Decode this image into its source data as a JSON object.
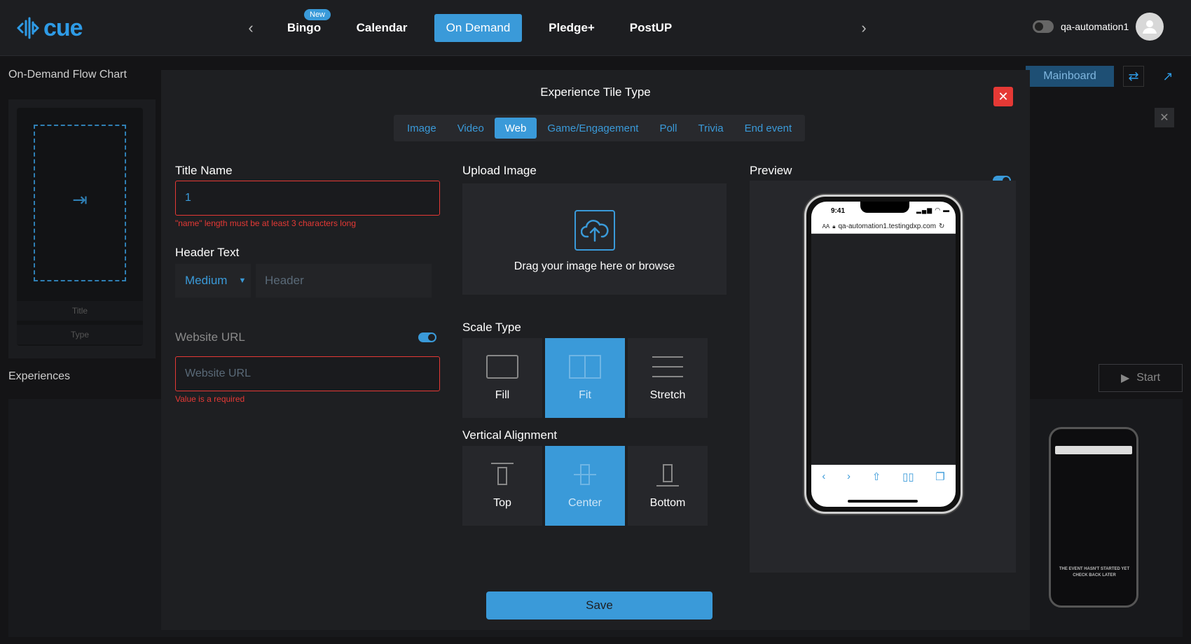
{
  "app": {
    "logo_text": "cue"
  },
  "nav": {
    "items": [
      {
        "label": "Bingo"
      },
      {
        "label": "Calendar"
      },
      {
        "label": "On Demand"
      },
      {
        "label": "Pledge+"
      },
      {
        "label": "PostUP"
      }
    ],
    "active": "On Demand",
    "new_badge": "New"
  },
  "user": {
    "name": "qa-automation1"
  },
  "background": {
    "flow_chart_title": "On-Demand Flow Chart",
    "experiences_title": "Experiences",
    "card_title": "Title",
    "card_type": "Type",
    "mainboard_label": "Mainboard",
    "start_label": "Start",
    "phone_text": "THE EVENT HASN'T STARTED YET CHECK BACK LATER"
  },
  "modal": {
    "title": "Experience Tile Type",
    "tabs": [
      {
        "label": "Image"
      },
      {
        "label": "Video"
      },
      {
        "label": "Web"
      },
      {
        "label": "Game/Engagement"
      },
      {
        "label": "Poll"
      },
      {
        "label": "Trivia"
      },
      {
        "label": "End event"
      }
    ],
    "active_tab": "Web",
    "title_name": {
      "label": "Title Name",
      "value": "1",
      "error": "\"name\" length must be at least 3 characters long"
    },
    "header_text": {
      "label": "Header Text",
      "size_value": "Medium",
      "placeholder": "Header"
    },
    "website_url": {
      "label": "Website URL",
      "placeholder": "Website URL",
      "error": "Value is a required",
      "toggle_on": true
    },
    "upload": {
      "label": "Upload Image",
      "text": "Drag your image here or browse"
    },
    "scale_type": {
      "label": "Scale Type",
      "options": [
        {
          "label": "Fill"
        },
        {
          "label": "Fit"
        },
        {
          "label": "Stretch"
        }
      ],
      "selected": "Fit"
    },
    "vertical_alignment": {
      "label": "Vertical Alignment",
      "options": [
        {
          "label": "Top"
        },
        {
          "label": "Center"
        },
        {
          "label": "Bottom"
        }
      ],
      "selected": "Center"
    },
    "preview": {
      "label": "Preview",
      "toggle_on": true,
      "time": "9:41",
      "url": "qa-automation1.testingdxp.com",
      "aa": "AA"
    },
    "save_label": "Save"
  },
  "colors": {
    "accent": "#3a9ad9",
    "error": "#e53935",
    "bg": "#141416",
    "modal": "#1e1f22"
  }
}
